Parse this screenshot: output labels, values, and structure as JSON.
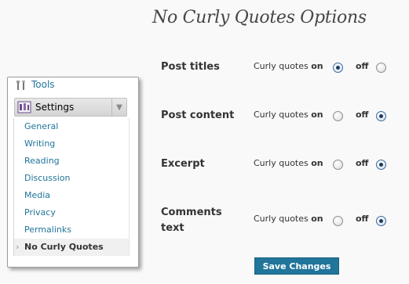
{
  "page": {
    "title": "No Curly Quotes Options"
  },
  "menu": {
    "tools_label": "Tools",
    "settings_label": "Settings",
    "items": [
      {
        "label": "General"
      },
      {
        "label": "Writing"
      },
      {
        "label": "Reading"
      },
      {
        "label": "Discussion"
      },
      {
        "label": "Media"
      },
      {
        "label": "Privacy"
      },
      {
        "label": "Permalinks"
      },
      {
        "label": "No Curly Quotes",
        "current": true
      }
    ]
  },
  "options": [
    {
      "label_line1": "Post titles",
      "label_line2": "",
      "on_prefix": "Curly quotes",
      "on_word": "on",
      "off_word": "off",
      "selected": "on"
    },
    {
      "label_line1": "Post content",
      "label_line2": "",
      "on_prefix": "Curly quotes",
      "on_word": "on",
      "off_word": "off",
      "selected": "off"
    },
    {
      "label_line1": "Excerpt",
      "label_line2": "",
      "on_prefix": "Curly quotes",
      "on_word": "on",
      "off_word": "off",
      "selected": "off"
    },
    {
      "label_line1": "Comments",
      "label_line2": "text",
      "on_prefix": "Curly quotes",
      "on_word": "on",
      "off_word": "off",
      "selected": "off"
    }
  ],
  "save_label": "Save Changes",
  "colors": {
    "link": "#21759b",
    "button_bg": "#21759b",
    "page_bg": "#f9f9f9"
  }
}
